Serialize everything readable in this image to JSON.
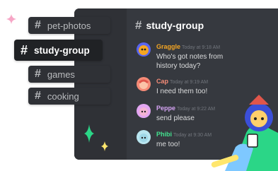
{
  "channels": [
    {
      "name": "pet-photos",
      "active": false
    },
    {
      "name": "study-group",
      "active": true
    },
    {
      "name": "games",
      "active": false
    },
    {
      "name": "cooking",
      "active": false
    }
  ],
  "header": {
    "channel": "study-group"
  },
  "messages": [
    {
      "author": "Graggle",
      "time": "Today at 9:18 AM",
      "color": "#f5a623",
      "lines": [
        "Who's got notes from",
        "history today?"
      ]
    },
    {
      "author": "Cap",
      "time": "Today at 9:19 AM",
      "color": "#f58b77",
      "lines": [
        "I need them too!"
      ]
    },
    {
      "author": "Peppe",
      "time": "Today at 9:22 AM",
      "color": "#d6a4f5",
      "lines": [
        "send please"
      ]
    },
    {
      "author": "Phibi",
      "time": "Today at 9:30 AM",
      "color": "#43e28f",
      "lines": [
        "me too!"
      ]
    }
  ],
  "colors": {
    "accent_green": "#2bd687",
    "sparkle_pink": "#f7a6c6",
    "sparkle_yellow": "#ffe66d"
  }
}
